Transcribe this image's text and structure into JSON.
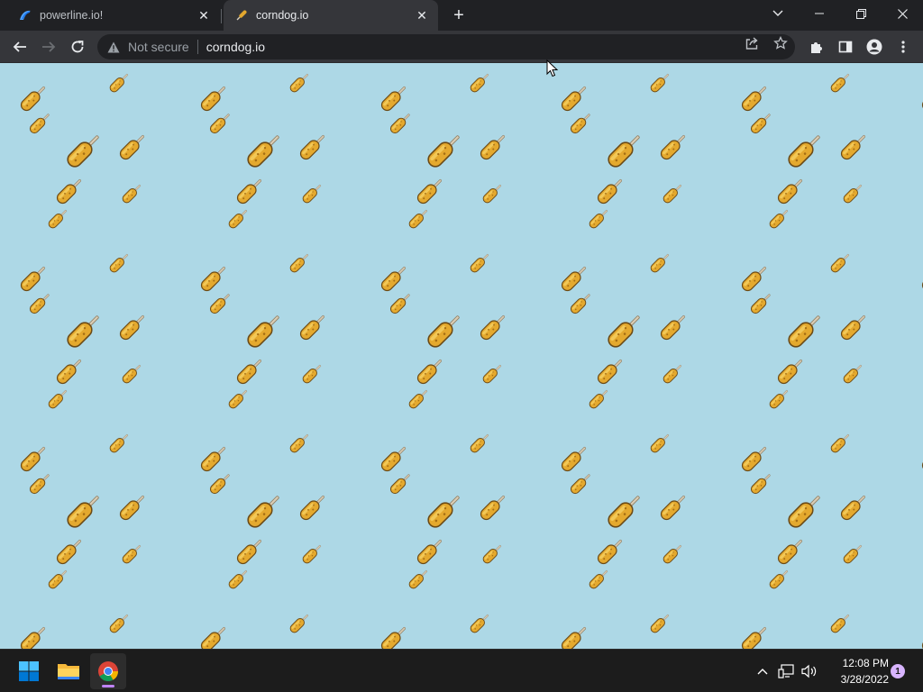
{
  "browser": {
    "tabs": [
      {
        "title": "powerline.io!",
        "favicon": "powerline-icon",
        "active": false
      },
      {
        "title": "corndog.io",
        "favicon": "corndog-icon",
        "active": true
      }
    ],
    "omnibox": {
      "security_label": "Not secure",
      "url": "corndog.io"
    }
  },
  "page": {
    "background_color": "#add8e6",
    "pattern_item": "corn-dog"
  },
  "taskbar": {
    "apps": [
      "windows-start",
      "file-explorer",
      "chrome"
    ],
    "time": "12:08 PM",
    "date": "3/28/2022",
    "notification_count": "1"
  },
  "colors": {
    "tab_active": "#35363a",
    "chrome_frame": "#202124",
    "accent": "#c084fc"
  }
}
